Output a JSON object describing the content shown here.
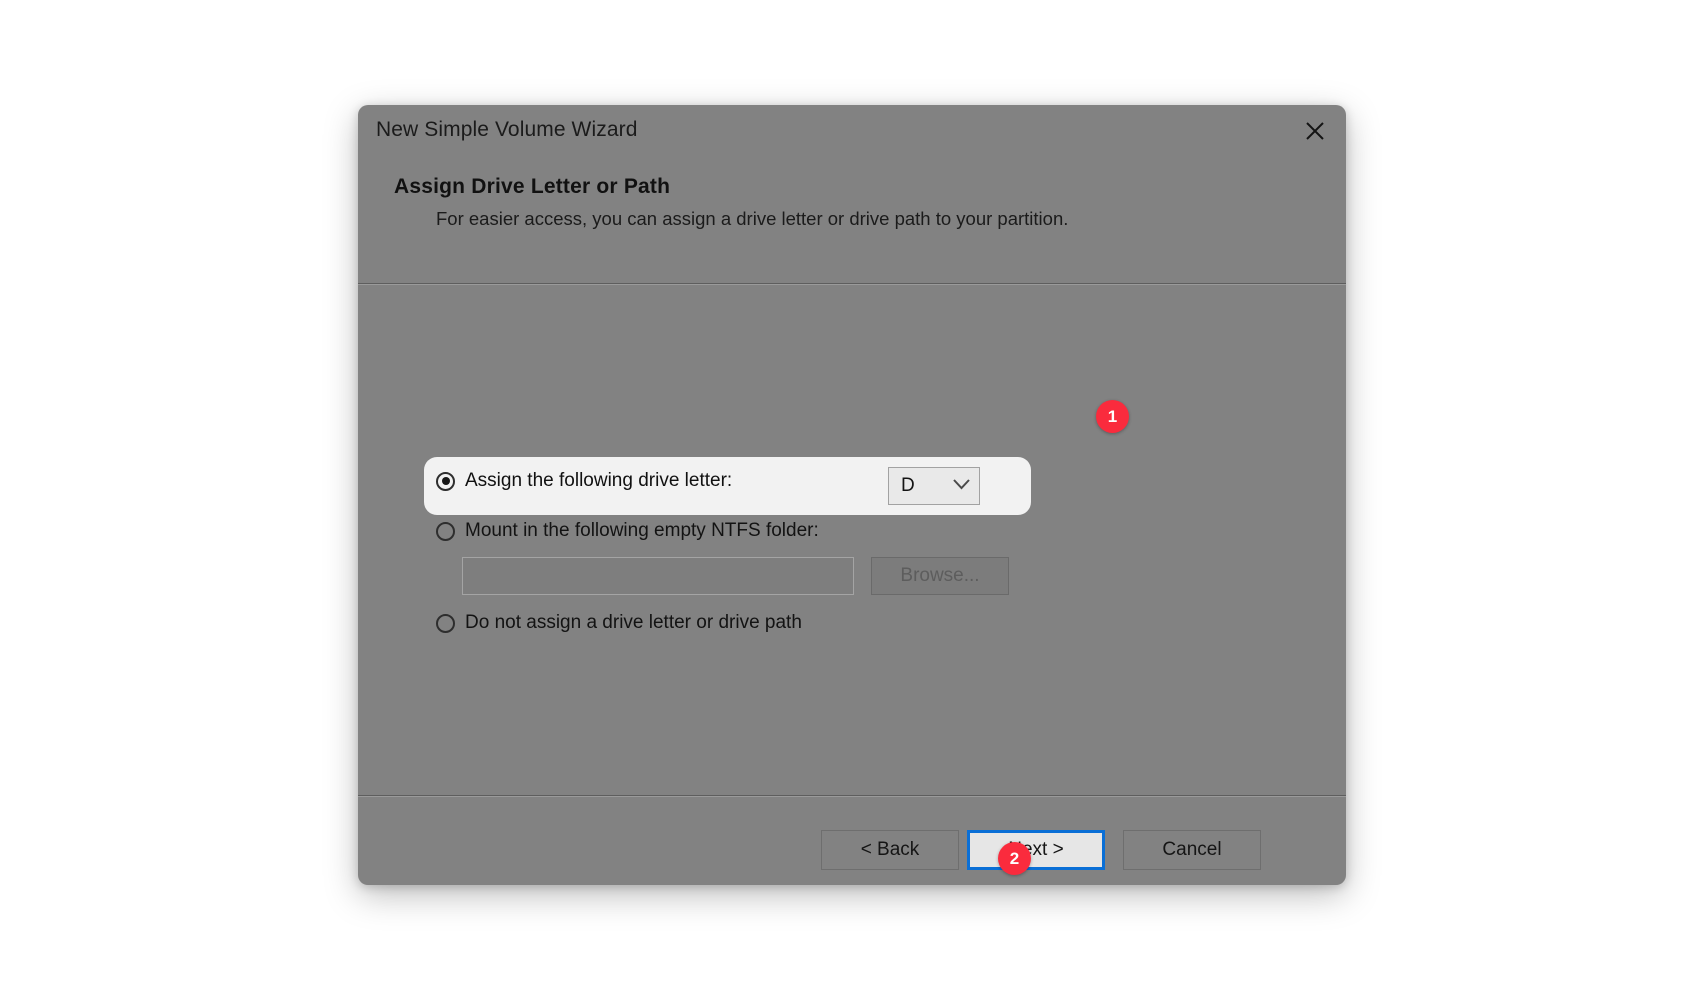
{
  "window": {
    "title": "New Simple Volume Wizard",
    "close_icon": "close-icon"
  },
  "header": {
    "title": "Assign Drive Letter or Path",
    "subtitle": "For easier access, you can assign a drive letter or drive path to your partition."
  },
  "options": {
    "assign_letter": {
      "label": "Assign the following drive letter:",
      "selected": true,
      "drive_select": {
        "value": "D",
        "chevron_icon": "chevron-down-icon"
      }
    },
    "mount_folder": {
      "label": "Mount in the following empty NTFS folder:",
      "selected": false,
      "path_value": "",
      "path_placeholder": "",
      "browse_label": "Browse..."
    },
    "no_assign": {
      "label": "Do not assign a drive letter or drive path",
      "selected": false
    }
  },
  "footer": {
    "back_label": "< Back",
    "next_label": "Next >",
    "cancel_label": "Cancel"
  },
  "annotations": [
    {
      "id": "1",
      "label": "1"
    },
    {
      "id": "2",
      "label": "2"
    }
  ],
  "colors": {
    "dialog_bg": "#828282",
    "focus_blue": "#0a6fd6",
    "badge_red": "#fa2b3d",
    "highlight_pill": "#f2f2f2"
  }
}
